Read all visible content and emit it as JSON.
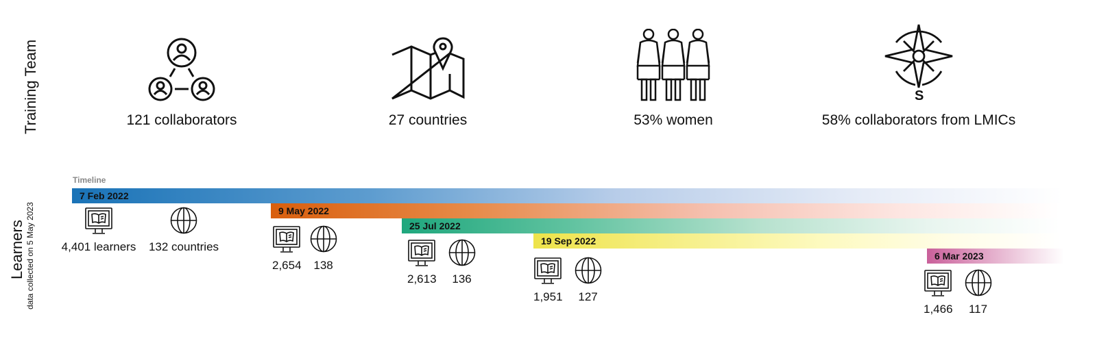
{
  "team": {
    "section_label": "Training Team",
    "stats": [
      {
        "icon": "collaborators-network-icon",
        "text": "121 collaborators"
      },
      {
        "icon": "map-pin-icon",
        "text": "27 countries"
      },
      {
        "icon": "women-group-icon",
        "text": "53% women"
      },
      {
        "icon": "compass-icon",
        "text": "58% collaborators from LMICs"
      }
    ]
  },
  "learners": {
    "section_label": "Learners",
    "note": "data collected on 5 May  2023",
    "timeline_label": "Timeline",
    "cohorts": [
      {
        "date": "7 Feb 2022",
        "color": "#1a73b7",
        "learners": "4,401 learners",
        "countries": "132 countries"
      },
      {
        "date": "9 May 2022",
        "color": "#d95f0e",
        "learners": "2,654",
        "countries": "138"
      },
      {
        "date": "25 Jul 2022",
        "color": "#1fa77d",
        "learners": "2,613",
        "countries": "136"
      },
      {
        "date": "19 Sep 2022",
        "color": "#eee34a",
        "learners": "1,951",
        "countries": "127"
      },
      {
        "date": "6 Mar 2023",
        "color": "#c9609a",
        "learners": "1,466",
        "countries": "117"
      }
    ]
  }
}
